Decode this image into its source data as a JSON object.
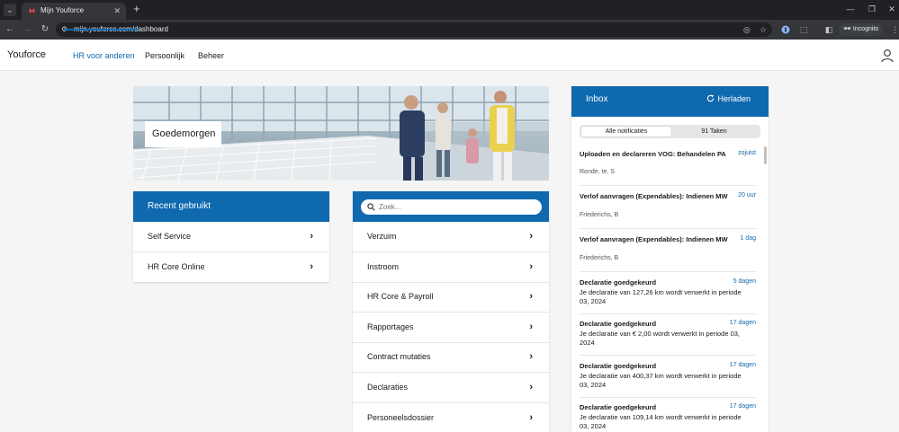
{
  "browser": {
    "tab_title": "Mijn Youforce",
    "url": "mijn.youforce.com/dashboard",
    "incognito_label": "Incognito"
  },
  "header": {
    "brand": "Youforce",
    "nav": [
      {
        "label": "HR voor anderen",
        "active": true
      },
      {
        "label": "Persoonlijk",
        "active": false
      },
      {
        "label": "Beheer",
        "active": false
      }
    ]
  },
  "hero": {
    "greeting": "Goedemorgen"
  },
  "recent": {
    "title": "Recent gebruikt",
    "items": [
      "Self Service",
      "HR Core Online"
    ]
  },
  "apps": {
    "search_placeholder": "Zoek...",
    "items": [
      "Verzuim",
      "Instroom",
      "HR Core & Payroll",
      "Rapportages",
      "Contract mutaties",
      "Declaraties",
      "Personeelsdossier"
    ]
  },
  "inbox": {
    "title": "Inbox",
    "reload_label": "Herladen",
    "tabs": [
      {
        "label": "Alle notificaties",
        "active": true
      },
      {
        "label": "91 Taken",
        "active": false
      }
    ],
    "notifications": [
      {
        "title": "Uploaden en declareren VOG: Behandelen PA",
        "time": "zojuist",
        "sub": "Ronde, te, S"
      },
      {
        "title": "Verlof aanvragen (Expendables): Indienen MW",
        "time": "20 uur",
        "sub": "Friederichs, B"
      },
      {
        "title": "Verlof aanvragen (Expendables): Indienen MW",
        "time": "1 dag",
        "sub": "Friederichs, B"
      },
      {
        "title": "Declaratie goedgekeurd",
        "time": "5 dagen",
        "body": "Je declaratie van 127,26 km wordt verwerkt in periode 03, 2024"
      },
      {
        "title": "Declaratie goedgekeurd",
        "time": "17 dagen",
        "body": "Je declaratie van € 2,00 wordt verwerkt in periode 03, 2024"
      },
      {
        "title": "Declaratie goedgekeurd",
        "time": "17 dagen",
        "body": "Je declaratie van 400,37 km wordt verwerkt in periode 03, 2024"
      },
      {
        "title": "Declaratie goedgekeurd",
        "time": "17 dagen",
        "body": "Je declaratie van 109,14 km wordt verwerkt in periode 03, 2024"
      }
    ]
  },
  "colors": {
    "primary": "#0f69af",
    "background": "#f5f5f5"
  }
}
